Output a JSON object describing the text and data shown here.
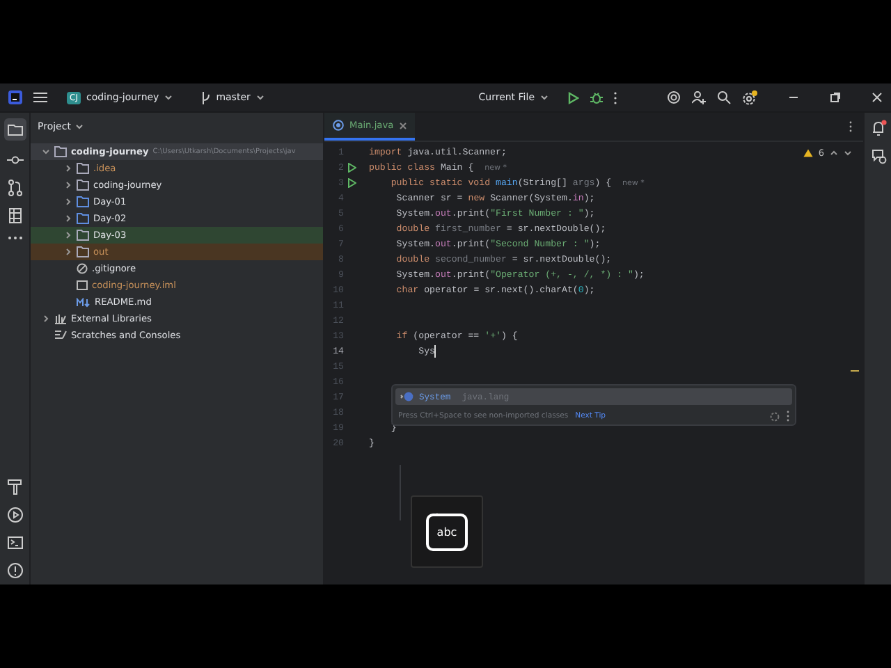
{
  "title_bar": {
    "project_badge": "CJ",
    "project": "coding-journey",
    "branch": "master",
    "run_config": "Current File"
  },
  "project_panel": {
    "title": "Project",
    "tree": [
      {
        "label": "coding-journey",
        "path": "C:\\Users\\Utkarsh\\Documents\\Projects\\jav",
        "kind": "module",
        "expanded": true,
        "ignored": false,
        "added": false,
        "excluded": false,
        "children": [
          {
            "label": ".idea",
            "kind": "folder",
            "expanded": false,
            "ignored": true,
            "added": false,
            "excluded": false
          },
          {
            "label": "coding-journey",
            "kind": "folder",
            "expanded": false,
            "ignored": false,
            "added": false,
            "excluded": false
          },
          {
            "label": "Day-01",
            "kind": "source",
            "expanded": false,
            "ignored": false,
            "added": false,
            "excluded": false
          },
          {
            "label": "Day-02",
            "kind": "source",
            "expanded": false,
            "ignored": false,
            "added": false,
            "excluded": false
          },
          {
            "label": "Day-03",
            "kind": "folder",
            "expanded": false,
            "ignored": false,
            "added": true,
            "excluded": false
          },
          {
            "label": "out",
            "kind": "folder",
            "expanded": false,
            "ignored": true,
            "added": false,
            "excluded": true
          },
          {
            "label": ".gitignore",
            "kind": "ignore",
            "ignored": false,
            "added": false,
            "excluded": false
          },
          {
            "label": "coding-journey.iml",
            "kind": "iml",
            "ignored": true,
            "added": false,
            "excluded": false
          },
          {
            "label": "README.md",
            "kind": "md",
            "ignored": false,
            "added": false,
            "excluded": false
          }
        ]
      },
      {
        "label": "External Libraries",
        "kind": "library",
        "expanded": false,
        "ignored": false,
        "added": false,
        "excluded": false
      },
      {
        "label": "Scratches and Consoles",
        "kind": "scratch",
        "ignored": false,
        "added": false,
        "excluded": false
      }
    ]
  },
  "editor": {
    "tabs": [
      {
        "label": "Main.java",
        "selected": true
      }
    ],
    "warnings": "6",
    "lines": [
      {
        "n": "1",
        "run": false,
        "current": false,
        "seg": [
          {
            "text": "import",
            "kind": "kw"
          },
          {
            "text": " java.util.Scanner;",
            "kind": "plain"
          }
        ]
      },
      {
        "n": "2",
        "run": true,
        "current": false,
        "seg": [
          {
            "text": "public class",
            "kind": "kw"
          },
          {
            "text": " Main {  ",
            "kind": "plain"
          },
          {
            "text": "new *",
            "kind": "hint"
          }
        ]
      },
      {
        "n": "3",
        "run": true,
        "current": false,
        "seg": [
          {
            "text": "    public static void ",
            "kind": "kw"
          },
          {
            "text": "main",
            "kind": "method"
          },
          {
            "text": "(String[] ",
            "kind": "plain"
          },
          {
            "text": "args",
            "kind": "unused"
          },
          {
            "text": ") {  ",
            "kind": "plain"
          },
          {
            "text": "new *",
            "kind": "hint"
          }
        ]
      },
      {
        "n": "4",
        "run": false,
        "current": false,
        "seg": [
          {
            "text": "     Scanner sr = ",
            "kind": "plain"
          },
          {
            "text": "new",
            "kind": "kw"
          },
          {
            "text": " Scanner(System.",
            "kind": "plain"
          },
          {
            "text": "in",
            "kind": "field"
          },
          {
            "text": ");",
            "kind": "plain"
          }
        ]
      },
      {
        "n": "5",
        "run": false,
        "current": false,
        "seg": [
          {
            "text": "     System.",
            "kind": "plain"
          },
          {
            "text": "out",
            "kind": "field"
          },
          {
            "text": ".print(",
            "kind": "plain"
          },
          {
            "text": "\"First Number : \"",
            "kind": "str"
          },
          {
            "text": ");",
            "kind": "plain"
          }
        ]
      },
      {
        "n": "6",
        "run": false,
        "current": false,
        "seg": [
          {
            "text": "     double ",
            "kind": "kw"
          },
          {
            "text": "first_number",
            "kind": "unused"
          },
          {
            "text": " = sr.nextDouble();",
            "kind": "plain"
          }
        ]
      },
      {
        "n": "7",
        "run": false,
        "current": false,
        "seg": [
          {
            "text": "     System.",
            "kind": "plain"
          },
          {
            "text": "out",
            "kind": "field"
          },
          {
            "text": ".print(",
            "kind": "plain"
          },
          {
            "text": "\"Second Number : \"",
            "kind": "str"
          },
          {
            "text": ");",
            "kind": "plain"
          }
        ]
      },
      {
        "n": "8",
        "run": false,
        "current": false,
        "seg": [
          {
            "text": "     double ",
            "kind": "kw"
          },
          {
            "text": "second_number",
            "kind": "unused"
          },
          {
            "text": " = sr.nextDouble();",
            "kind": "plain"
          }
        ]
      },
      {
        "n": "9",
        "run": false,
        "current": false,
        "seg": [
          {
            "text": "     System.",
            "kind": "plain"
          },
          {
            "text": "out",
            "kind": "field"
          },
          {
            "text": ".print(",
            "kind": "plain"
          },
          {
            "text": "\"Operator (+, -, /, *) : \"",
            "kind": "str"
          },
          {
            "text": ");",
            "kind": "plain"
          }
        ]
      },
      {
        "n": "10",
        "run": false,
        "current": false,
        "seg": [
          {
            "text": "     char ",
            "kind": "kw"
          },
          {
            "text": "operator = sr.next().charAt(",
            "kind": "plain"
          },
          {
            "text": "0",
            "kind": "num"
          },
          {
            "text": ");",
            "kind": "plain"
          }
        ]
      },
      {
        "n": "11",
        "run": false,
        "current": false
      },
      {
        "n": "12",
        "run": false,
        "current": false
      },
      {
        "n": "13",
        "run": false,
        "current": false,
        "seg": [
          {
            "text": "     if",
            "kind": "kw"
          },
          {
            "text": " (operator == ",
            "kind": "plain"
          },
          {
            "text": "'+'",
            "kind": "str"
          },
          {
            "text": ") {",
            "kind": "plain"
          }
        ]
      },
      {
        "n": "14",
        "run": false,
        "current": true,
        "seg": [
          {
            "text": "         Sys",
            "kind": "plain"
          }
        ]
      },
      {
        "n": "15",
        "run": false,
        "current": false
      },
      {
        "n": "16",
        "run": false,
        "current": false
      },
      {
        "n": "17",
        "run": false,
        "current": false
      },
      {
        "n": "18",
        "run": false,
        "current": false
      },
      {
        "n": "19",
        "run": false,
        "current": false,
        "seg": [
          {
            "text": "    }",
            "kind": "plain"
          }
        ]
      },
      {
        "n": "20",
        "run": false,
        "current": false,
        "seg": [
          {
            "text": "}",
            "kind": "plain"
          }
        ]
      }
    ]
  },
  "completion": {
    "items": [
      {
        "name": "System",
        "package": "java.lang",
        "selected": true
      }
    ],
    "tip": "Press Ctrl+Space to see non-imported classes",
    "next_tip": "Next Tip"
  },
  "keyboard_indicator": {
    "label": "abc"
  }
}
